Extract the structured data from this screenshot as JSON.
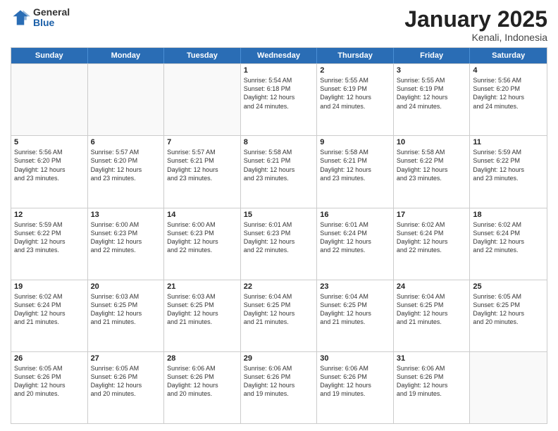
{
  "logo": {
    "general": "General",
    "blue": "Blue"
  },
  "title": "January 2025",
  "location": "Kenali, Indonesia",
  "header_days": [
    "Sunday",
    "Monday",
    "Tuesday",
    "Wednesday",
    "Thursday",
    "Friday",
    "Saturday"
  ],
  "weeks": [
    [
      {
        "day": "",
        "info": ""
      },
      {
        "day": "",
        "info": ""
      },
      {
        "day": "",
        "info": ""
      },
      {
        "day": "1",
        "info": "Sunrise: 5:54 AM\nSunset: 6:18 PM\nDaylight: 12 hours\nand 24 minutes."
      },
      {
        "day": "2",
        "info": "Sunrise: 5:55 AM\nSunset: 6:19 PM\nDaylight: 12 hours\nand 24 minutes."
      },
      {
        "day": "3",
        "info": "Sunrise: 5:55 AM\nSunset: 6:19 PM\nDaylight: 12 hours\nand 24 minutes."
      },
      {
        "day": "4",
        "info": "Sunrise: 5:56 AM\nSunset: 6:20 PM\nDaylight: 12 hours\nand 24 minutes."
      }
    ],
    [
      {
        "day": "5",
        "info": "Sunrise: 5:56 AM\nSunset: 6:20 PM\nDaylight: 12 hours\nand 23 minutes."
      },
      {
        "day": "6",
        "info": "Sunrise: 5:57 AM\nSunset: 6:20 PM\nDaylight: 12 hours\nand 23 minutes."
      },
      {
        "day": "7",
        "info": "Sunrise: 5:57 AM\nSunset: 6:21 PM\nDaylight: 12 hours\nand 23 minutes."
      },
      {
        "day": "8",
        "info": "Sunrise: 5:58 AM\nSunset: 6:21 PM\nDaylight: 12 hours\nand 23 minutes."
      },
      {
        "day": "9",
        "info": "Sunrise: 5:58 AM\nSunset: 6:21 PM\nDaylight: 12 hours\nand 23 minutes."
      },
      {
        "day": "10",
        "info": "Sunrise: 5:58 AM\nSunset: 6:22 PM\nDaylight: 12 hours\nand 23 minutes."
      },
      {
        "day": "11",
        "info": "Sunrise: 5:59 AM\nSunset: 6:22 PM\nDaylight: 12 hours\nand 23 minutes."
      }
    ],
    [
      {
        "day": "12",
        "info": "Sunrise: 5:59 AM\nSunset: 6:22 PM\nDaylight: 12 hours\nand 23 minutes."
      },
      {
        "day": "13",
        "info": "Sunrise: 6:00 AM\nSunset: 6:23 PM\nDaylight: 12 hours\nand 22 minutes."
      },
      {
        "day": "14",
        "info": "Sunrise: 6:00 AM\nSunset: 6:23 PM\nDaylight: 12 hours\nand 22 minutes."
      },
      {
        "day": "15",
        "info": "Sunrise: 6:01 AM\nSunset: 6:23 PM\nDaylight: 12 hours\nand 22 minutes."
      },
      {
        "day": "16",
        "info": "Sunrise: 6:01 AM\nSunset: 6:24 PM\nDaylight: 12 hours\nand 22 minutes."
      },
      {
        "day": "17",
        "info": "Sunrise: 6:02 AM\nSunset: 6:24 PM\nDaylight: 12 hours\nand 22 minutes."
      },
      {
        "day": "18",
        "info": "Sunrise: 6:02 AM\nSunset: 6:24 PM\nDaylight: 12 hours\nand 22 minutes."
      }
    ],
    [
      {
        "day": "19",
        "info": "Sunrise: 6:02 AM\nSunset: 6:24 PM\nDaylight: 12 hours\nand 21 minutes."
      },
      {
        "day": "20",
        "info": "Sunrise: 6:03 AM\nSunset: 6:25 PM\nDaylight: 12 hours\nand 21 minutes."
      },
      {
        "day": "21",
        "info": "Sunrise: 6:03 AM\nSunset: 6:25 PM\nDaylight: 12 hours\nand 21 minutes."
      },
      {
        "day": "22",
        "info": "Sunrise: 6:04 AM\nSunset: 6:25 PM\nDaylight: 12 hours\nand 21 minutes."
      },
      {
        "day": "23",
        "info": "Sunrise: 6:04 AM\nSunset: 6:25 PM\nDaylight: 12 hours\nand 21 minutes."
      },
      {
        "day": "24",
        "info": "Sunrise: 6:04 AM\nSunset: 6:25 PM\nDaylight: 12 hours\nand 21 minutes."
      },
      {
        "day": "25",
        "info": "Sunrise: 6:05 AM\nSunset: 6:25 PM\nDaylight: 12 hours\nand 20 minutes."
      }
    ],
    [
      {
        "day": "26",
        "info": "Sunrise: 6:05 AM\nSunset: 6:26 PM\nDaylight: 12 hours\nand 20 minutes."
      },
      {
        "day": "27",
        "info": "Sunrise: 6:05 AM\nSunset: 6:26 PM\nDaylight: 12 hours\nand 20 minutes."
      },
      {
        "day": "28",
        "info": "Sunrise: 6:06 AM\nSunset: 6:26 PM\nDaylight: 12 hours\nand 20 minutes."
      },
      {
        "day": "29",
        "info": "Sunrise: 6:06 AM\nSunset: 6:26 PM\nDaylight: 12 hours\nand 19 minutes."
      },
      {
        "day": "30",
        "info": "Sunrise: 6:06 AM\nSunset: 6:26 PM\nDaylight: 12 hours\nand 19 minutes."
      },
      {
        "day": "31",
        "info": "Sunrise: 6:06 AM\nSunset: 6:26 PM\nDaylight: 12 hours\nand 19 minutes."
      },
      {
        "day": "",
        "info": ""
      }
    ]
  ]
}
